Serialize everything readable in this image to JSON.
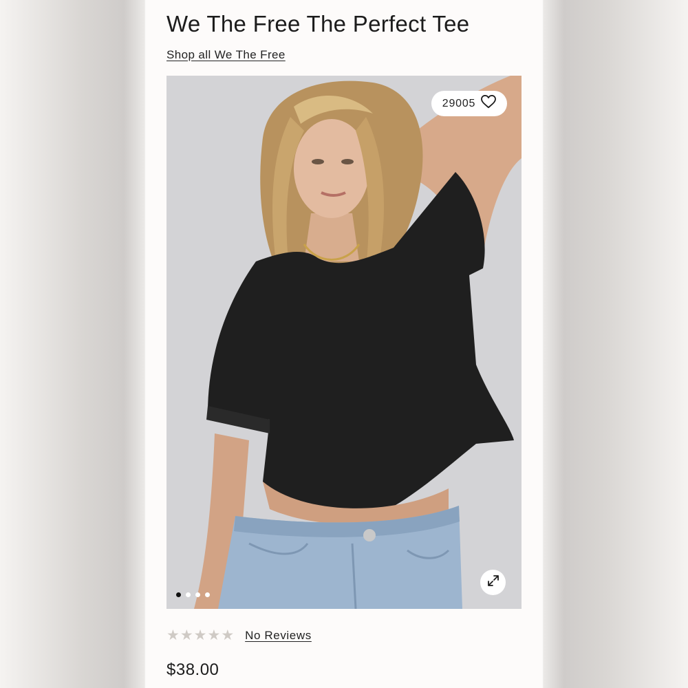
{
  "product": {
    "title": "We The Free The Perfect Tee",
    "shop_link": "Shop all We The Free",
    "favorites_count": "29005",
    "price": "$38.00"
  },
  "gallery": {
    "slide_count": 4,
    "active_slide": 1
  },
  "reviews": {
    "stars": [
      "★",
      "★",
      "★",
      "★",
      "★"
    ],
    "rating": 0,
    "label": "No Reviews"
  },
  "colors": {
    "star_empty": "#cfcac5",
    "tee": "#1d1d1d",
    "denim": "#9bb4cf"
  },
  "icons": [
    "heart-icon",
    "expand-icon",
    "star-icon"
  ]
}
